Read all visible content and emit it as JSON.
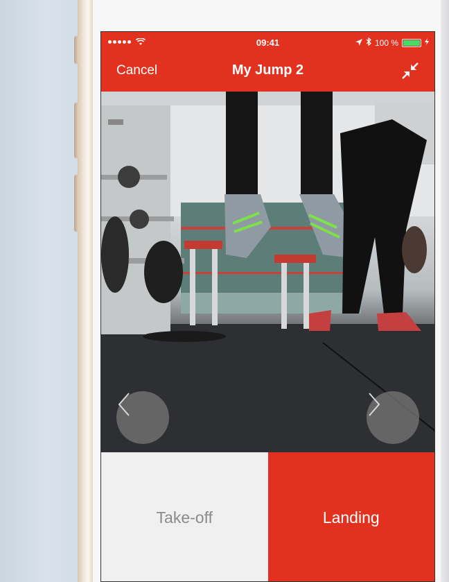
{
  "status_bar": {
    "time": "09:41",
    "battery": "100 %"
  },
  "header": {
    "cancel_label": "Cancel",
    "title": "My Jump 2"
  },
  "toggle": {
    "takeoff_label": "Take-off",
    "landing_label": "Landing",
    "selected": "Landing"
  },
  "colors": {
    "accent": "#e2321f",
    "inactive_bg": "#f0f0f0",
    "inactive_text": "#8a8a8a"
  },
  "icons": {
    "collapse": "collapse-arrows-icon",
    "prev": "chevron-left-icon",
    "next": "chevron-right-icon"
  }
}
